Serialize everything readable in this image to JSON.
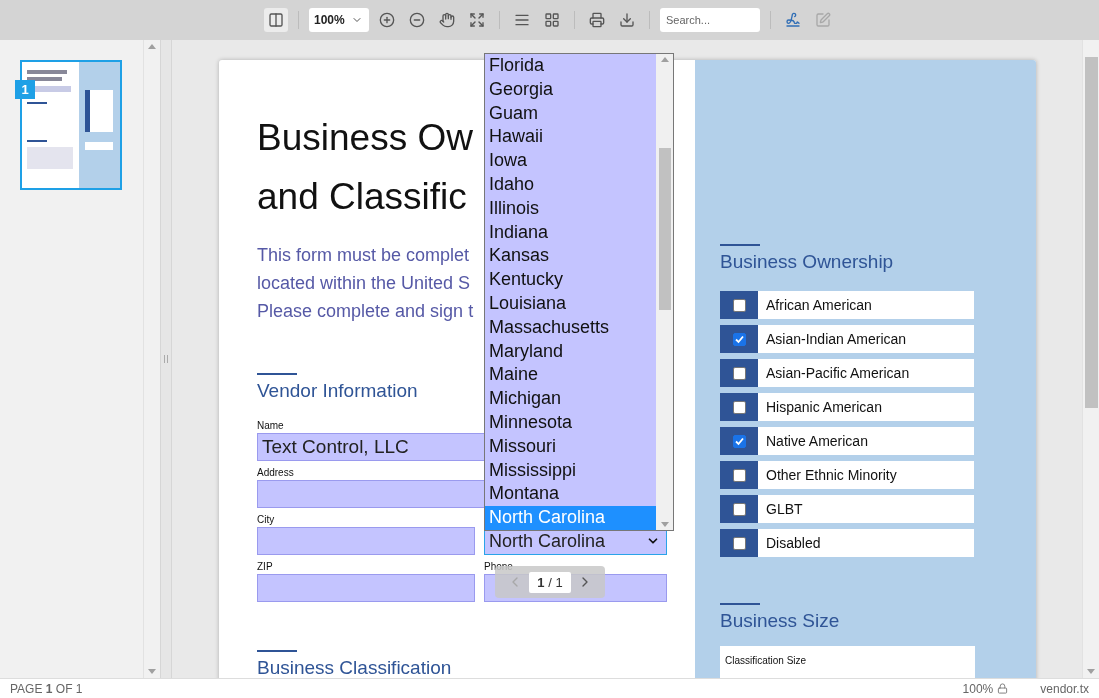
{
  "toolbar": {
    "sidebar_toggle": {
      "on": true
    },
    "zoom": "100%",
    "search": {
      "placeholder": "Search..."
    },
    "edit_button": {
      "disabled": true
    }
  },
  "thumbnails": [
    {
      "number": "1",
      "selected": true
    }
  ],
  "document": {
    "title_lines": [
      "Business Ow",
      "and Classific"
    ],
    "intro_lines": [
      "This form must be complet",
      "located within the United S",
      "Please complete and sign t"
    ],
    "vendor": {
      "heading": "Vendor Information",
      "rows": [
        {
          "fields": [
            {
              "kind": "text",
              "label": "Name",
              "value": "Text Control, LLC"
            }
          ]
        },
        {
          "fields": [
            {
              "kind": "text",
              "label": "Address"
            }
          ]
        },
        {
          "fields": [
            {
              "kind": "text",
              "label": "City"
            },
            {
              "kind": "select",
              "value": "North Carolina"
            }
          ]
        },
        {
          "fields": [
            {
              "kind": "text",
              "label": "ZIP"
            },
            {
              "kind": "text",
              "label": "Phone"
            }
          ]
        }
      ]
    },
    "classification_heading": "Business Classification",
    "ownership": {
      "heading": "Business Ownership",
      "options": [
        {
          "label": "African American",
          "checked": false
        },
        {
          "label": "Asian-Indian American",
          "checked": true
        },
        {
          "label": "Asian-Pacific American",
          "checked": false
        },
        {
          "label": "Hispanic American",
          "checked": false
        },
        {
          "label": "Native American",
          "checked": true
        },
        {
          "label": "Other Ethnic Minority",
          "checked": false
        },
        {
          "label": "GLBT",
          "checked": false
        },
        {
          "label": "Disabled",
          "checked": false
        }
      ]
    },
    "size": {
      "heading": "Business Size",
      "field_label": "Classification Size"
    }
  },
  "state_dropdown": {
    "options": [
      {
        "label": "Florida",
        "selected": false
      },
      {
        "label": "Georgia",
        "selected": false
      },
      {
        "label": "Guam",
        "selected": false
      },
      {
        "label": "Hawaii",
        "selected": false
      },
      {
        "label": "Iowa",
        "selected": false
      },
      {
        "label": "Idaho",
        "selected": false
      },
      {
        "label": "Illinois",
        "selected": false
      },
      {
        "label": "Indiana",
        "selected": false
      },
      {
        "label": "Kansas",
        "selected": false
      },
      {
        "label": "Kentucky",
        "selected": false
      },
      {
        "label": "Louisiana",
        "selected": false
      },
      {
        "label": "Massachusetts",
        "selected": false
      },
      {
        "label": "Maryland",
        "selected": false
      },
      {
        "label": "Maine",
        "selected": false
      },
      {
        "label": "Michigan",
        "selected": false
      },
      {
        "label": "Minnesota",
        "selected": false
      },
      {
        "label": "Missouri",
        "selected": false
      },
      {
        "label": "Mississippi",
        "selected": false
      },
      {
        "label": "Montana",
        "selected": false
      },
      {
        "label": "North Carolina",
        "selected": true
      }
    ]
  },
  "pager": {
    "current": "1",
    "total": "/ 1"
  },
  "status_bar": {
    "page": "PAGE **1** OF 1",
    "zoom": "100%",
    "file": "vendor.tx"
  }
}
